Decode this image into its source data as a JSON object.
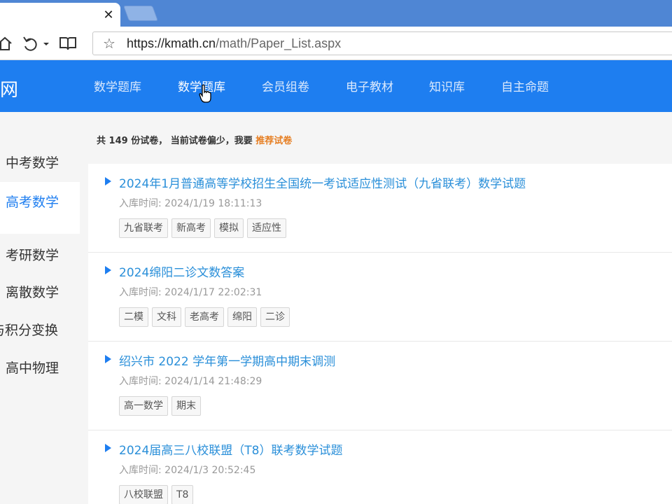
{
  "browser": {
    "url_host": "https://kmath.cn",
    "url_path": "/math/Paper_List.aspx",
    "close_glyph": "✕"
  },
  "site": {
    "brand": "网",
    "nav": [
      "数学题库",
      "数学题库",
      "会员组卷",
      "电子教材",
      "知识库",
      "自主命题"
    ]
  },
  "sidebar": {
    "items": [
      "中考数学",
      "高考数学",
      "考研数学",
      "离散数学",
      "与积分变换",
      "高中物理"
    ]
  },
  "summary": {
    "prefix": "共",
    "count": "149",
    "mid": "份试卷，  当前试卷偏少，我要",
    "link": "推荐试卷"
  },
  "papers": [
    {
      "title": "2024年1月普通高等学校招生全国统一考试适应性测试（九省联考）数学试题",
      "date": "入库时间: 2024/1/19 18:11:13",
      "tags": [
        "九省联考",
        "新高考",
        "模拟",
        "适应性"
      ]
    },
    {
      "title": "2024绵阳二诊文数答案",
      "date": "入库时间: 2024/1/17 22:02:31",
      "tags": [
        "二模",
        "文科",
        "老高考",
        "绵阳",
        "二诊"
      ]
    },
    {
      "title": "绍兴市 2022 学年第一学期高中期末调测",
      "date": "入库时间: 2024/1/14 21:48:29",
      "tags": [
        "高一数学",
        "期末"
      ]
    },
    {
      "title": "2024届高三八校联盟（T8）联考数学试题",
      "date": "入库时间: 2024/1/3 20:52:45",
      "tags": [
        "八校联盟",
        "T8"
      ]
    }
  ],
  "colors": {
    "nav_bg": "#1e7ef0",
    "tab_strip": "#4f86d4",
    "title_link": "#2a8fd9",
    "recommend_link": "#e67e22"
  }
}
